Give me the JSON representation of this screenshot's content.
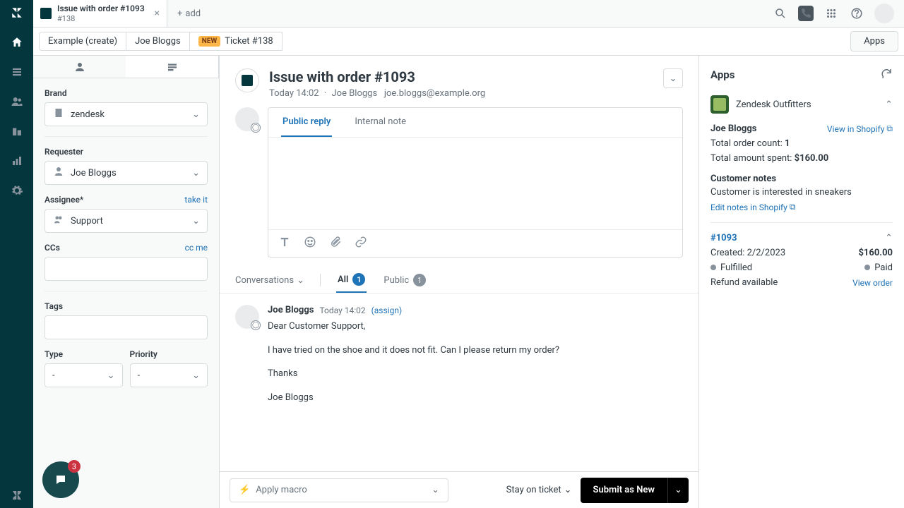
{
  "nav": {
    "chat_badge": "3"
  },
  "tab": {
    "title": "Issue with order #1093",
    "sub": "#138",
    "add": "add"
  },
  "crumbs": {
    "c1": "Example (create)",
    "c2": "Joe Bloggs",
    "pill": "NEW",
    "c3": "Ticket #138",
    "apps": "Apps"
  },
  "left": {
    "brand_lbl": "Brand",
    "brand_val": "zendesk",
    "req_lbl": "Requester",
    "req_val": "Joe Bloggs",
    "assignee_lbl": "Assignee*",
    "take": "take it",
    "assignee_val": "Support",
    "ccs_lbl": "CCs",
    "ccme": "cc me",
    "tags_lbl": "Tags",
    "type_lbl": "Type",
    "type_val": "-",
    "prio_lbl": "Priority",
    "prio_val": "-"
  },
  "ticket": {
    "title": "Issue with order #1093",
    "time": "Today 14:02",
    "sep": "·",
    "requester": "Joe Bloggs",
    "email": "joe.bloggs@example.org"
  },
  "composer": {
    "public": "Public reply",
    "internal": "Internal note"
  },
  "conv": {
    "label": "Conversations",
    "all": "All",
    "all_n": "1",
    "public": "Public",
    "public_n": "1"
  },
  "msg": {
    "author": "Joe Bloggs",
    "time": "Today 14:02",
    "assign": "(assign)",
    "p1": "Dear Customer Support,",
    "p2": "I have tried on the shoe and it does not fit. Can I please return my order?",
    "p3": "Thanks",
    "p4": "Joe Bloggs"
  },
  "footer": {
    "macro": "Apply macro",
    "stay": "Stay on ticket",
    "submit": "Submit as New"
  },
  "apps": {
    "title": "Apps",
    "app_name": "Zendesk Outfitters",
    "cust_name": "Joe Bloggs",
    "view_shopify": "View in Shopify",
    "order_count_lbl": "Total order count: ",
    "order_count": "1",
    "amount_lbl": "Total amount spent: ",
    "amount": "$160.00",
    "notes_h": "Customer notes",
    "notes_v": "Customer is interested in sneakers",
    "edit_notes": "Edit notes in Shopify",
    "order_num": "#1093",
    "created_lbl": "Created: ",
    "created": "2/2/2023",
    "order_total": "$160.00",
    "fulfilled": "Fulfilled",
    "paid": "Paid",
    "refund": "Refund available",
    "view_order": "View order"
  }
}
